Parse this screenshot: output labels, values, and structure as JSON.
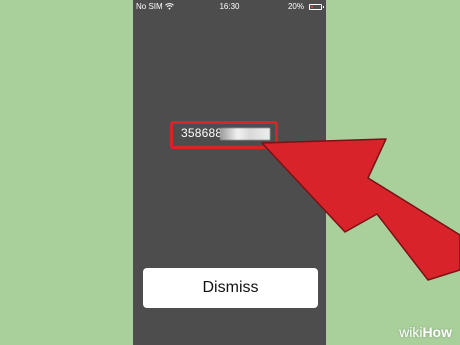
{
  "status_bar": {
    "carrier": "No SIM",
    "wifi_icon": "wifi-icon",
    "time": "16:30",
    "battery_percent": "20%",
    "battery_level": 0.2,
    "battery_color": "#e8322d"
  },
  "dialog": {
    "code_visible": "358688",
    "code_obscured": true,
    "dismiss_label": "Dismiss"
  },
  "annotation": {
    "highlight_color": "#d8232a",
    "arrow_color": "#d8232a",
    "arrow_icon": "pointer-arrow-icon"
  },
  "branding": {
    "logo_wiki": "wiki",
    "logo_how": "How"
  }
}
